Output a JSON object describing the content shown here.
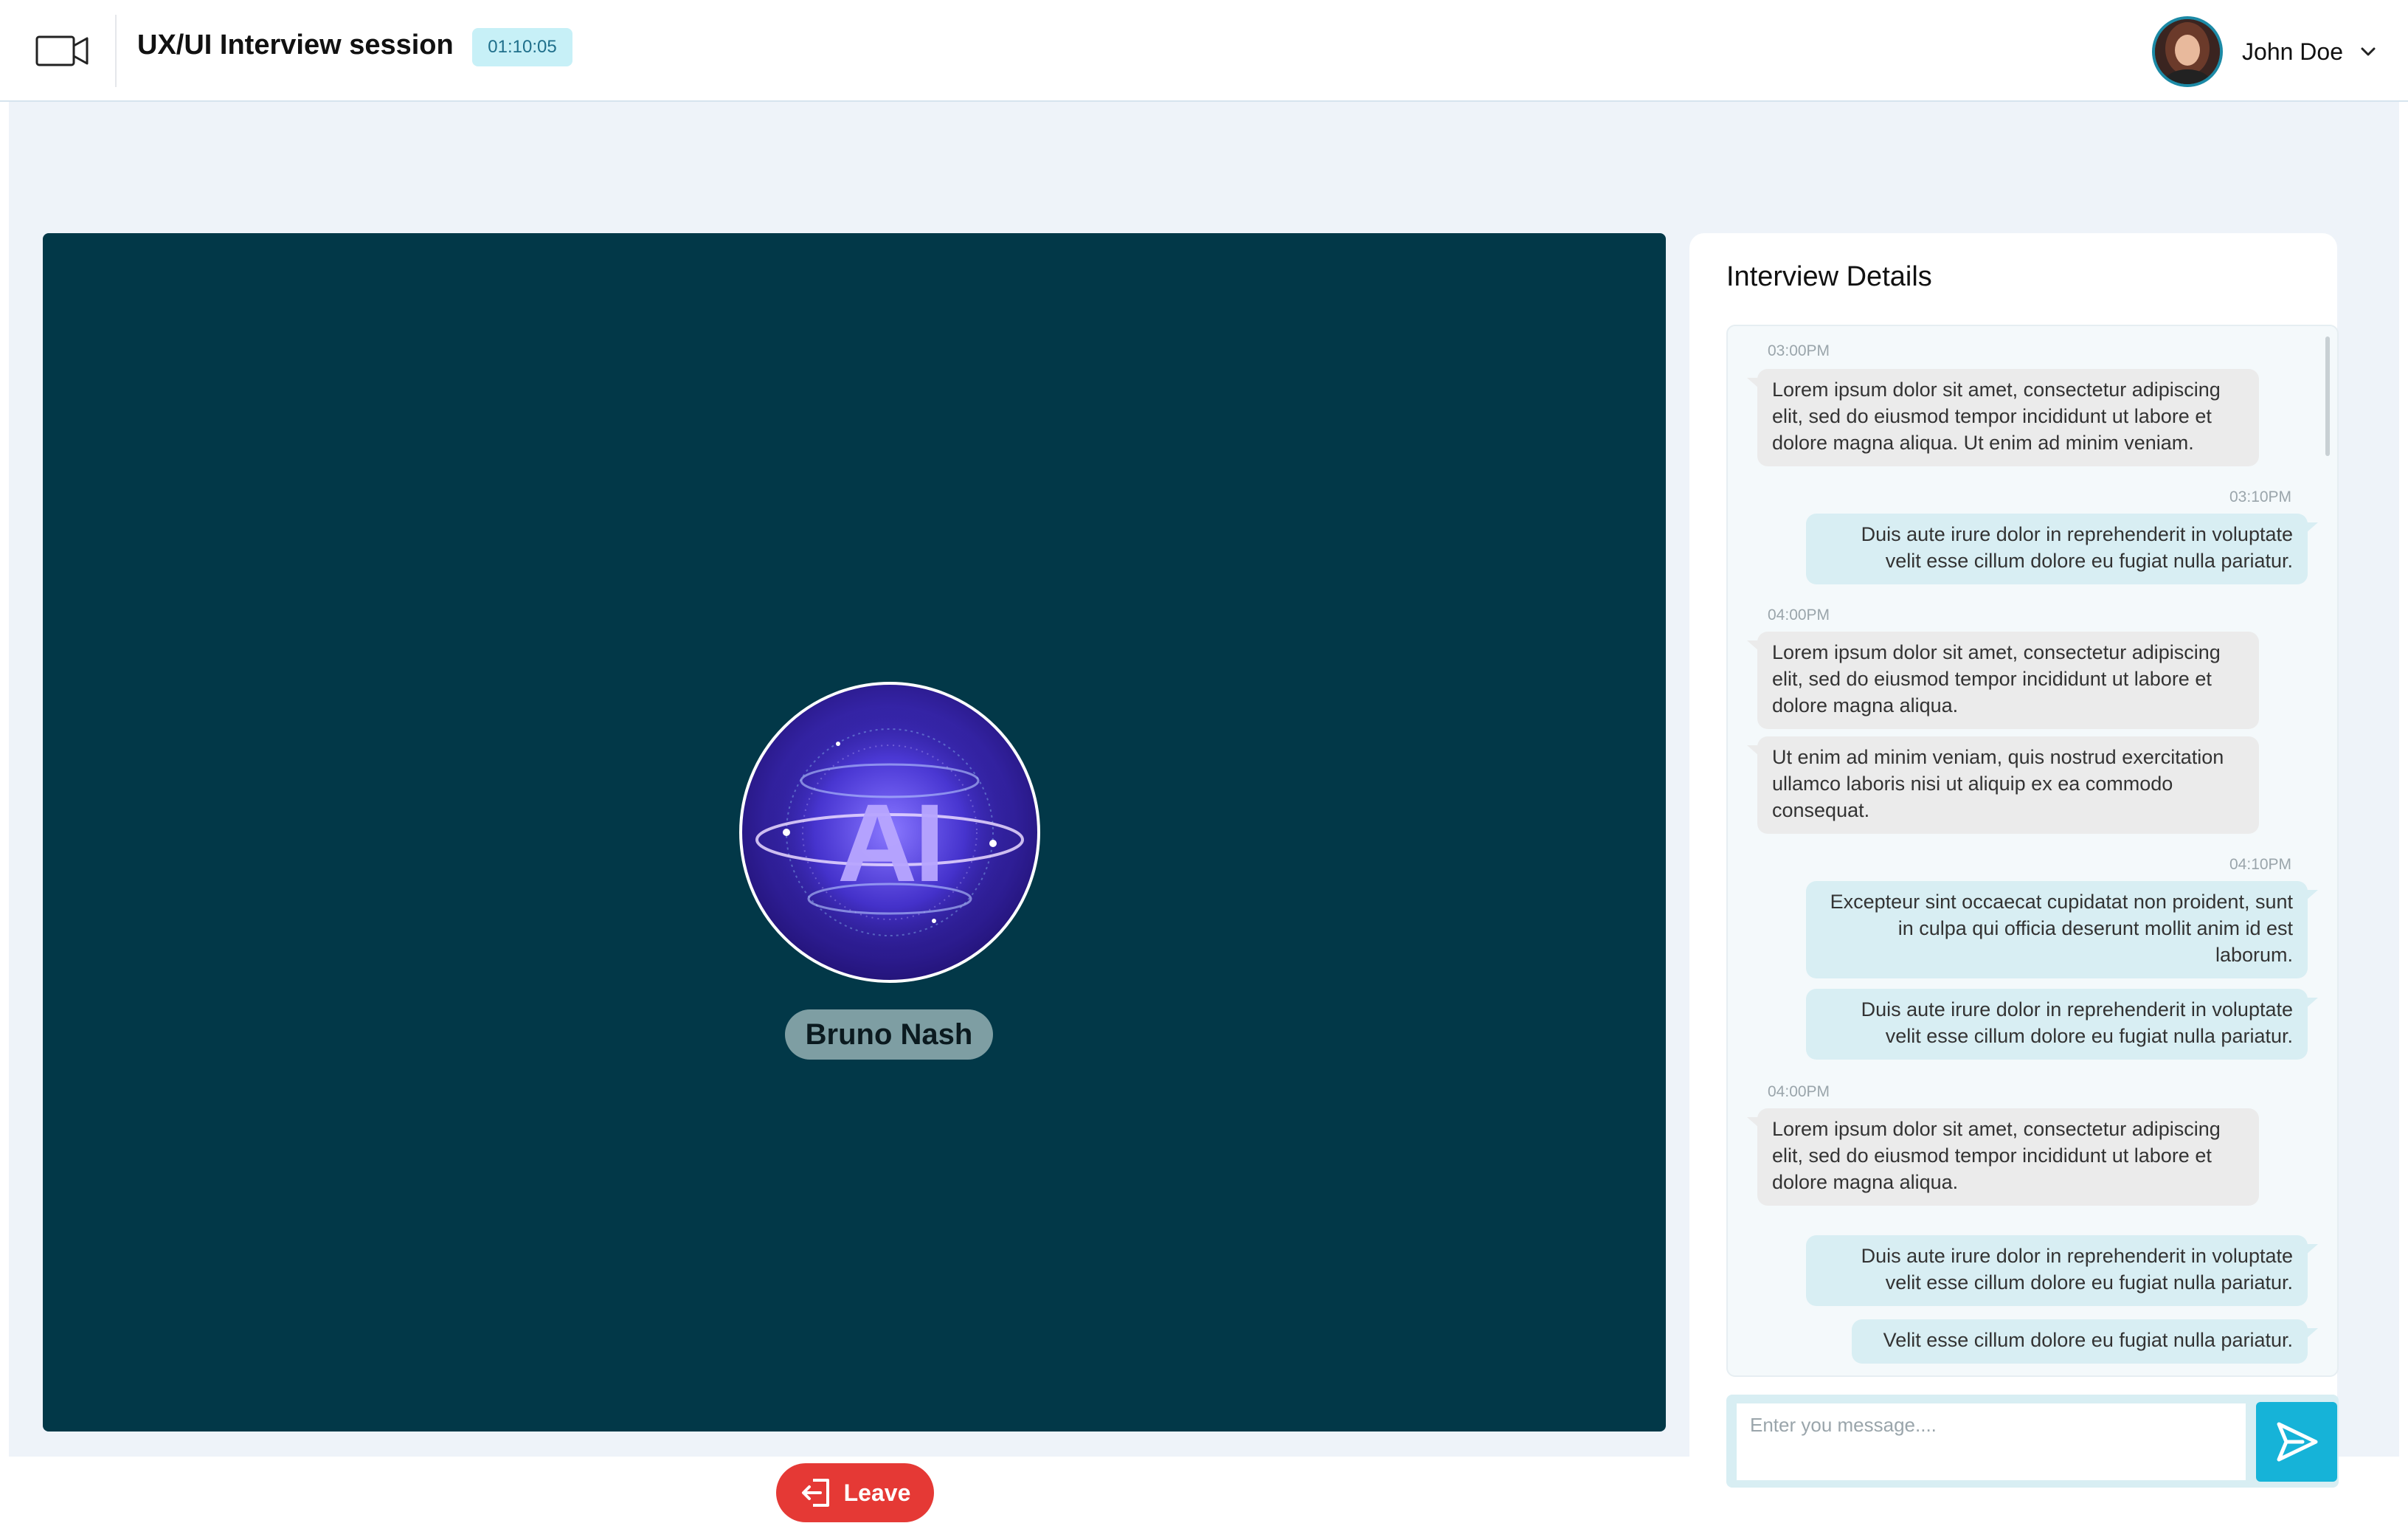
{
  "header": {
    "title": "UX/UI Interview session",
    "timer": "01:10:05",
    "user_name": "John Doe",
    "icons": {
      "camera": "video-camera-icon",
      "dropdown": "chevron-down-icon"
    }
  },
  "stage": {
    "participant_name": "Bruno Nash",
    "avatar_text": "AI",
    "background_color": "#023848"
  },
  "leave": {
    "label": "Leave",
    "color": "#e53935",
    "icon": "exit-icon"
  },
  "panel": {
    "title": "Interview Details",
    "messages": [
      {
        "time": "03:00PM",
        "direction": "in",
        "text": "Lorem ipsum dolor sit amet, consectetur adipiscing elit, sed do eiusmod tempor incididunt ut labore et dolore magna aliqua. Ut enim ad minim veniam."
      },
      {
        "time": "03:10PM",
        "direction": "out",
        "text": "Duis aute irure dolor in reprehenderit in voluptate velit esse cillum dolore eu fugiat nulla pariatur."
      },
      {
        "time": "04:00PM",
        "direction": "in",
        "text": "Lorem ipsum dolor sit amet, consectetur adipiscing elit, sed do eiusmod tempor incididunt ut labore et dolore magna aliqua."
      },
      {
        "time": "",
        "direction": "in",
        "text": "Ut enim ad minim veniam, quis nostrud exercitation ullamco laboris nisi ut aliquip ex ea commodo consequat."
      },
      {
        "time": "04:10PM",
        "direction": "out",
        "text": "Excepteur sint occaecat cupidatat non proident, sunt in culpa qui officia deserunt mollit anim id est laborum."
      },
      {
        "time": "",
        "direction": "out",
        "text": "Duis aute irure dolor in reprehenderit in voluptate velit esse cillum dolore eu fugiat nulla pariatur."
      },
      {
        "time": "04:00PM",
        "direction": "in",
        "text": "Lorem ipsum dolor sit amet, consectetur adipiscing elit, sed do eiusmod tempor incididunt ut labore et dolore magna aliqua."
      },
      {
        "time": "",
        "direction": "out",
        "text": "Duis aute irure dolor in reprehenderit in voluptate velit esse cillum dolore eu fugiat nulla pariatur."
      },
      {
        "time": "",
        "direction": "out",
        "text": "Velit esse cillum dolore eu fugiat nulla pariatur."
      }
    ],
    "composer": {
      "placeholder": "Enter you message....",
      "send_icon": "send-icon"
    }
  },
  "colors": {
    "accent": "#16b3d8",
    "timer_bg": "#c7f0f7",
    "incoming_bubble": "#ebebeb",
    "outgoing_bubble": "#d8eef3"
  }
}
